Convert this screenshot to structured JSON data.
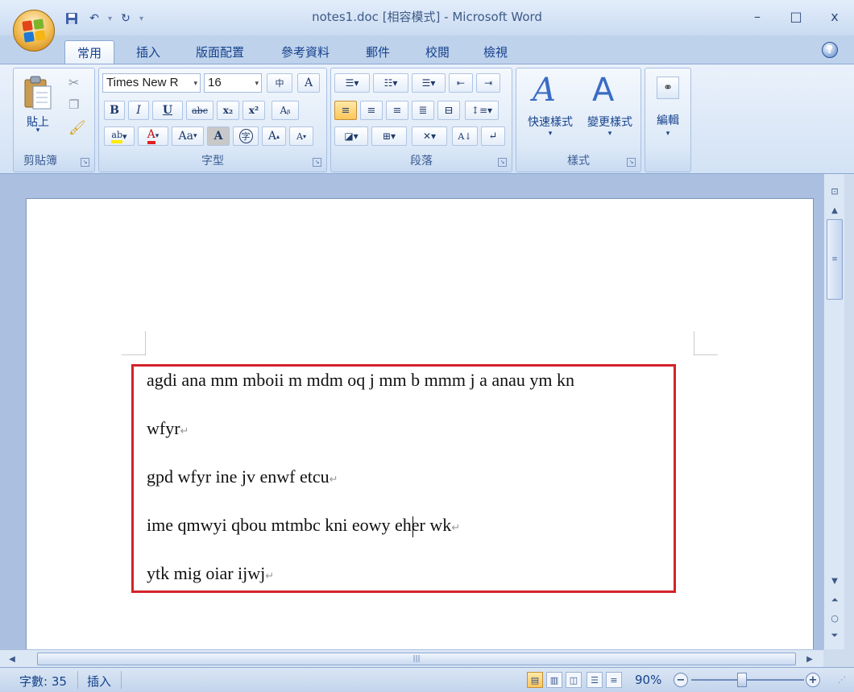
{
  "window": {
    "title": "notes1.doc [相容模式] - Microsoft Word",
    "minimize": "–",
    "maximize": "□",
    "close": "x"
  },
  "qat": {
    "dropdown": "▾"
  },
  "tabs": [
    {
      "label": "常用"
    },
    {
      "label": "插入"
    },
    {
      "label": "版面配置"
    },
    {
      "label": "參考資料"
    },
    {
      "label": "郵件"
    },
    {
      "label": "校閱"
    },
    {
      "label": "檢視"
    }
  ],
  "help": {
    "label": "?"
  },
  "ribbon": {
    "clipboard": {
      "label": "剪貼簿",
      "paste_label": "貼上"
    },
    "font": {
      "label": "字型",
      "font_name": "Times New R",
      "font_size": "16",
      "bold": "B",
      "italic": "I",
      "underline": "U",
      "strike": "abc",
      "subscript": "x₂",
      "superscript": "x²",
      "change_case": "Aa",
      "char_shade": "A",
      "grow": "A",
      "shrink": "A",
      "highlight": "ab",
      "font_color": "A",
      "char_border": "A",
      "enclose": "字"
    },
    "paragraph": {
      "label": "段落"
    },
    "styles": {
      "label": "樣式",
      "quick_styles": "快速樣式",
      "change_styles": "變更樣式"
    },
    "editing": {
      "label": "編輯"
    }
  },
  "document": {
    "paragraphs": [
      "agdi ana mm mboii m mdm oq j mm b mmm j a anau ym kn",
      "wfyr",
      "gpd wfyr ine jv enwf etcu",
      "ime qmwyi qbou mtmbc kni eowy eher wk",
      "ytk mig oiar ijwj"
    ],
    "paragraph_mark": "↵"
  },
  "statusbar": {
    "word_count": "字數: 35",
    "mode": "插入",
    "zoom": "90%"
  }
}
